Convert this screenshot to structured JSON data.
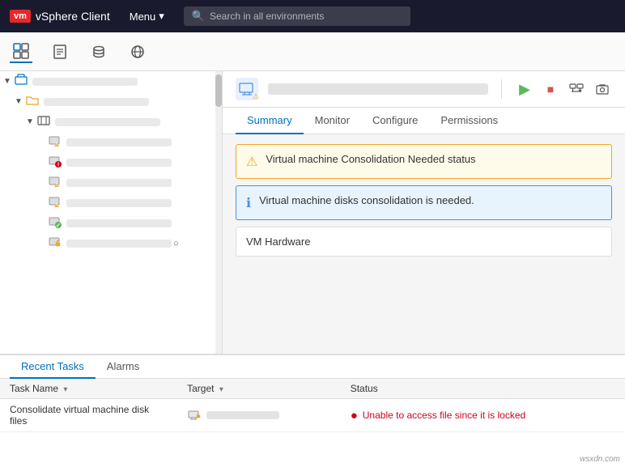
{
  "app": {
    "logo": "vm",
    "title": "vSphere Client",
    "menu_label": "Menu",
    "search_placeholder": "Search in all environments"
  },
  "toolbar_icons": [
    {
      "name": "home-icon",
      "symbol": "⊞",
      "active": true
    },
    {
      "name": "pages-icon",
      "symbol": "⊡",
      "active": false
    },
    {
      "name": "database-icon",
      "symbol": "🗄",
      "active": false
    },
    {
      "name": "globe-icon",
      "symbol": "🌐",
      "active": false
    }
  ],
  "sidebar": {
    "items": [
      {
        "level": 0,
        "has_arrow": true,
        "arrow": "▼",
        "icon_type": "datacenter",
        "icon": "🏢",
        "blurred": true
      },
      {
        "level": 1,
        "has_arrow": true,
        "arrow": "▼",
        "icon_type": "folder",
        "icon": "📁",
        "blurred": true
      },
      {
        "level": 2,
        "has_arrow": true,
        "arrow": "▼",
        "icon_type": "cluster",
        "icon": "📦",
        "blurred": true
      },
      {
        "level": 3,
        "has_arrow": false,
        "icon_type": "vm-warning",
        "icon": "⚠",
        "blurred": true
      },
      {
        "level": 3,
        "has_arrow": false,
        "icon_type": "vm-error",
        "icon": "🔴",
        "blurred": true
      },
      {
        "level": 3,
        "has_arrow": false,
        "icon_type": "vm-warning",
        "icon": "⚠",
        "blurred": true
      },
      {
        "level": 3,
        "has_arrow": false,
        "icon_type": "vm-warning",
        "icon": "⚠",
        "blurred": true
      },
      {
        "level": 3,
        "has_arrow": false,
        "icon_type": "vm-ok",
        "icon": "💻",
        "blurred": true
      },
      {
        "level": 3,
        "has_arrow": false,
        "icon_type": "vm-lock",
        "icon": "🔒",
        "blurred": true
      }
    ]
  },
  "content_header": {
    "entity_icon": "⚠",
    "action_icons": [
      {
        "name": "play-icon",
        "symbol": "▶",
        "color": "#5cb85c"
      },
      {
        "name": "stop-icon",
        "symbol": "■",
        "color": "#d9534f"
      },
      {
        "name": "migrate-icon",
        "symbol": "⇄"
      },
      {
        "name": "snapshot-icon",
        "symbol": "📷"
      }
    ]
  },
  "tabs": [
    {
      "label": "Summary",
      "active": true
    },
    {
      "label": "Monitor",
      "active": false
    },
    {
      "label": "Configure",
      "active": false
    },
    {
      "label": "Permissions",
      "active": false
    }
  ],
  "alerts": [
    {
      "type": "warning",
      "icon": "⚠",
      "text": "Virtual machine Consolidation Needed status"
    },
    {
      "type": "info",
      "icon": "ℹ",
      "text": "Virtual machine disks consolidation is needed."
    }
  ],
  "vm_hardware": {
    "label": "VM Hardware"
  },
  "bottom_panel": {
    "tabs": [
      {
        "label": "Recent Tasks",
        "active": true
      },
      {
        "label": "Alarms",
        "active": false
      }
    ],
    "task_table": {
      "columns": [
        {
          "label": "Task Name",
          "sortable": true
        },
        {
          "label": "Target",
          "sortable": true
        },
        {
          "label": "Status",
          "sortable": false
        }
      ],
      "rows": [
        {
          "task_name": "Consolidate virtual machine disk files",
          "target_blurred": true,
          "status_type": "error",
          "status_text": "Unable to access file since it is locked"
        }
      ]
    }
  },
  "watermark": "wsxdn.com"
}
